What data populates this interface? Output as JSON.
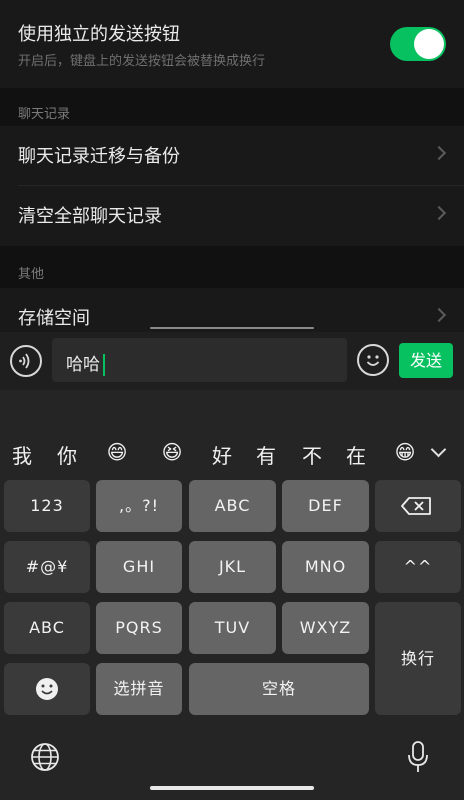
{
  "settings": {
    "toggle_row": {
      "title": "使用独立的发送按钮",
      "subtitle": "开启后，键盘上的发送按钮会被替换成换行",
      "enabled": true
    },
    "section_chat": "聊天记录",
    "chat_items": [
      {
        "label": "聊天记录迁移与备份"
      },
      {
        "label": "清空全部聊天记录"
      }
    ],
    "section_other": "其他",
    "other_items": [
      {
        "label": "存储空间"
      }
    ]
  },
  "input_bar": {
    "value": "哈哈",
    "send_label": "发送"
  },
  "keyboard": {
    "candidates": [
      "我",
      "你",
      "😄",
      "😆",
      "好",
      "有",
      "不",
      "在",
      "😁"
    ],
    "rows": [
      [
        "123",
        ",。?!",
        "ABC",
        "DEF",
        "⌫"
      ],
      [
        "#@¥",
        "GHI",
        "JKL",
        "MNO",
        "^^"
      ],
      [
        "ABC",
        "PQRS",
        "TUV",
        "WXYZ",
        "换行"
      ],
      [
        "☺",
        "选拼音",
        "空格"
      ]
    ]
  },
  "icons": {
    "voice": "voice-icon",
    "emoji": "emoji-icon",
    "backspace": "backspace-icon",
    "globe": "globe-icon",
    "mic": "microphone-icon",
    "chevron": "chevron-right-icon"
  },
  "colors": {
    "accent": "#07c160",
    "background": "#191919"
  }
}
